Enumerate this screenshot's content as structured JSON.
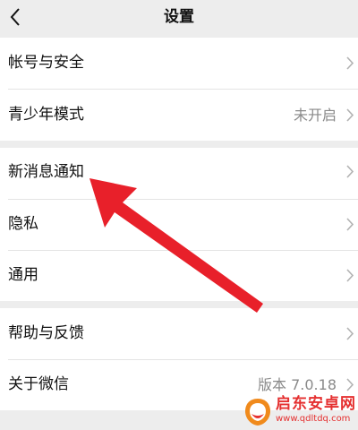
{
  "navbar": {
    "title": "设置",
    "back_icon": "chevron-left-icon"
  },
  "groups": [
    {
      "items": [
        {
          "label": "帐号与安全",
          "value": ""
        },
        {
          "label": "青少年模式",
          "value": "未开启"
        }
      ]
    },
    {
      "items": [
        {
          "label": "新消息通知",
          "value": ""
        },
        {
          "label": "隐私",
          "value": ""
        },
        {
          "label": "通用",
          "value": ""
        }
      ]
    },
    {
      "items": [
        {
          "label": "帮助与反馈",
          "value": ""
        },
        {
          "label": "关于微信",
          "value": "版本 7.0.18"
        }
      ]
    }
  ],
  "annotation": {
    "type": "red-arrow",
    "color": "#e8202a",
    "points_to": "新消息通知"
  },
  "watermark": {
    "name": "启东安卓网",
    "url": "www.qdltdq.com",
    "color": "#e53030"
  }
}
